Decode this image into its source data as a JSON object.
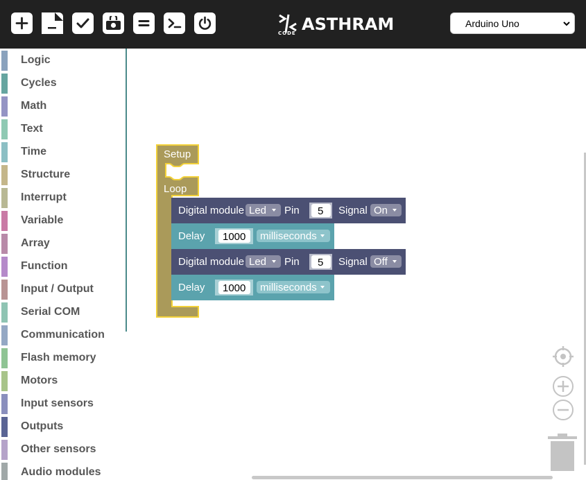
{
  "toolbar": {
    "buttons": [
      {
        "name": "new-button",
        "icon": "plus-icon"
      },
      {
        "name": "open-button",
        "icon": "folder-icon"
      },
      {
        "name": "verify-button",
        "icon": "check-icon"
      },
      {
        "name": "save-button",
        "icon": "camera-icon"
      },
      {
        "name": "equal-button",
        "icon": "equals-icon"
      },
      {
        "name": "terminal-button",
        "icon": "terminal-icon"
      },
      {
        "name": "power-button",
        "icon": "power-icon"
      }
    ],
    "logo_text": "ASTHRAM",
    "logo_sub": "CODE",
    "board_select": "Arduino Uno"
  },
  "toolbox": {
    "categories": [
      {
        "label": "Logic",
        "color": "#8aa2bd"
      },
      {
        "label": "Cycles",
        "color": "#66a5a0"
      },
      {
        "label": "Math",
        "color": "#9494c4"
      },
      {
        "label": "Text",
        "color": "#8fc9b3"
      },
      {
        "label": "Time",
        "color": "#8cbfc4"
      },
      {
        "label": "Structure",
        "color": "#c4b68a"
      },
      {
        "label": "Interrupt",
        "color": "#b8b894"
      },
      {
        "label": "Variable",
        "color": "#c97aa5"
      },
      {
        "label": "Array",
        "color": "#b88aa8"
      },
      {
        "label": "Function",
        "color": "#b58ac9"
      },
      {
        "label": "Input / Output",
        "color": "#b89494"
      },
      {
        "label": "Serial COM",
        "color": "#8fc4b3"
      },
      {
        "label": "Communication",
        "color": "#94a8c4"
      },
      {
        "label": "Flash memory",
        "color": "#8fc494"
      },
      {
        "label": "Motors",
        "color": "#a8c48a"
      },
      {
        "label": "Input sensors",
        "color": "#8a8fbd"
      },
      {
        "label": "Outputs",
        "color": "#5a6494"
      },
      {
        "label": "Other sensors",
        "color": "#b5a3c9"
      },
      {
        "label": "Audio modules",
        "color": "#a0a8a8"
      }
    ]
  },
  "blocks": {
    "setup_label": "Setup",
    "loop_label": "Loop",
    "digital1": {
      "label": "Digital module",
      "module": "Led",
      "pin_label": "Pin",
      "pin": "5",
      "signal_label": "Signal",
      "signal": "On"
    },
    "delay1": {
      "label": "Delay",
      "value": "1000",
      "unit": "milliseconds"
    },
    "digital2": {
      "label": "Digital module",
      "module": "Led",
      "pin_label": "Pin",
      "pin": "5",
      "signal_label": "Signal",
      "signal": "Off"
    },
    "delay2": {
      "label": "Delay",
      "value": "1000",
      "unit": "milliseconds"
    },
    "colors": {
      "setup_loop": "#aa9a5a",
      "setup_outline": "#f2d13a",
      "digital": "#4b5073",
      "delay": "#5ba3ad"
    }
  },
  "workspace_controls": [
    "recenter-icon",
    "zoom-in-icon",
    "zoom-out-icon",
    "trash-icon"
  ]
}
